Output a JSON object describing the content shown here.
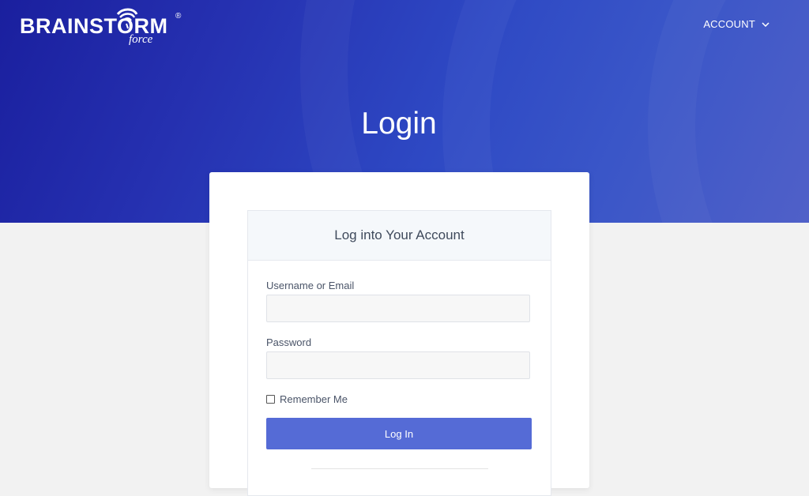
{
  "brand": {
    "name": "BRAINSTORM",
    "sub": "force",
    "reg": "®"
  },
  "nav": {
    "account_label": "ACCOUNT"
  },
  "page": {
    "title": "Login"
  },
  "login_form": {
    "heading": "Log into Your Account",
    "username_label": "Username or Email",
    "username_value": "",
    "password_label": "Password",
    "password_value": "",
    "remember_label": "Remember Me",
    "remember_checked": false,
    "submit_label": "Log In"
  },
  "colors": {
    "hero_start": "#1a1f9e",
    "hero_end": "#5060c8",
    "button": "#556bd6",
    "background": "#f2f2f2"
  },
  "icons": {
    "account_dropdown": "chevron-down-icon",
    "logo_mark": "storm-swirl-icon"
  }
}
